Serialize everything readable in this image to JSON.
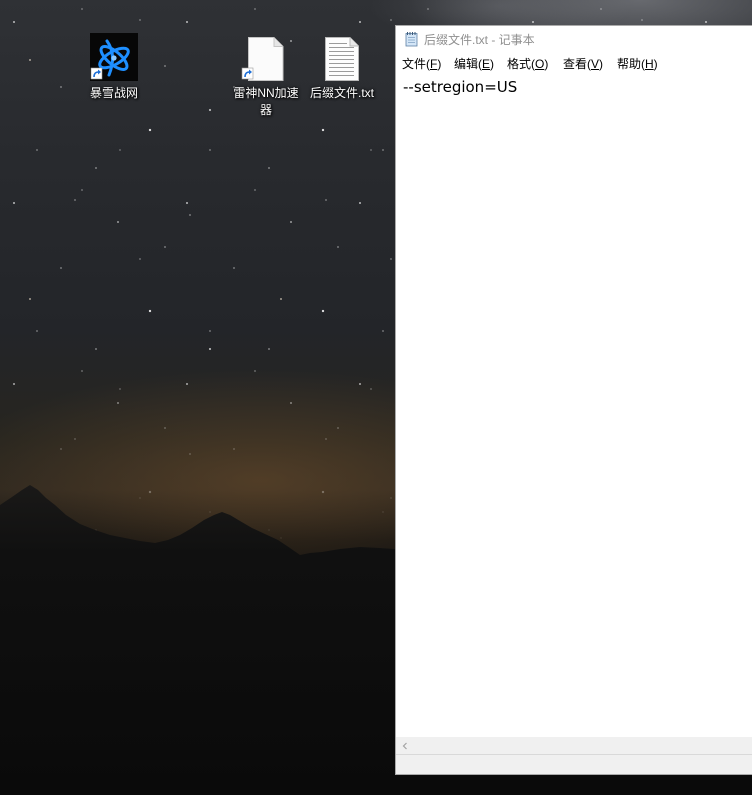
{
  "desktop": {
    "icons": [
      {
        "label": "暴雪战网",
        "icon": "battle-net-icon",
        "shortcut": true
      },
      {
        "label": "雷神NN加速器",
        "icon": "blank-file-icon",
        "shortcut": true
      },
      {
        "label": "后缀文件.txt",
        "icon": "text-file-icon",
        "shortcut": false
      }
    ]
  },
  "notepad": {
    "app_icon": "notepad-icon",
    "title": "后缀文件.txt - 记事本",
    "menu": [
      {
        "label": "文件(F)"
      },
      {
        "label": "编辑(E)"
      },
      {
        "label": "格式(O)"
      },
      {
        "label": "查看(V)"
      },
      {
        "label": "帮助(H)"
      }
    ],
    "content": "--setregion=US",
    "scrollbar": {
      "left_arrow_icon": "scroll-left-arrow-icon"
    }
  },
  "colors": {
    "window_border": "#aaaaaa",
    "title_text": "#8f8f8f",
    "menu_text": "#000000",
    "editor_bg": "#ffffff",
    "scrollbar_bg": "#f0f0f0",
    "battle_net_blue": "#1e8fff"
  }
}
